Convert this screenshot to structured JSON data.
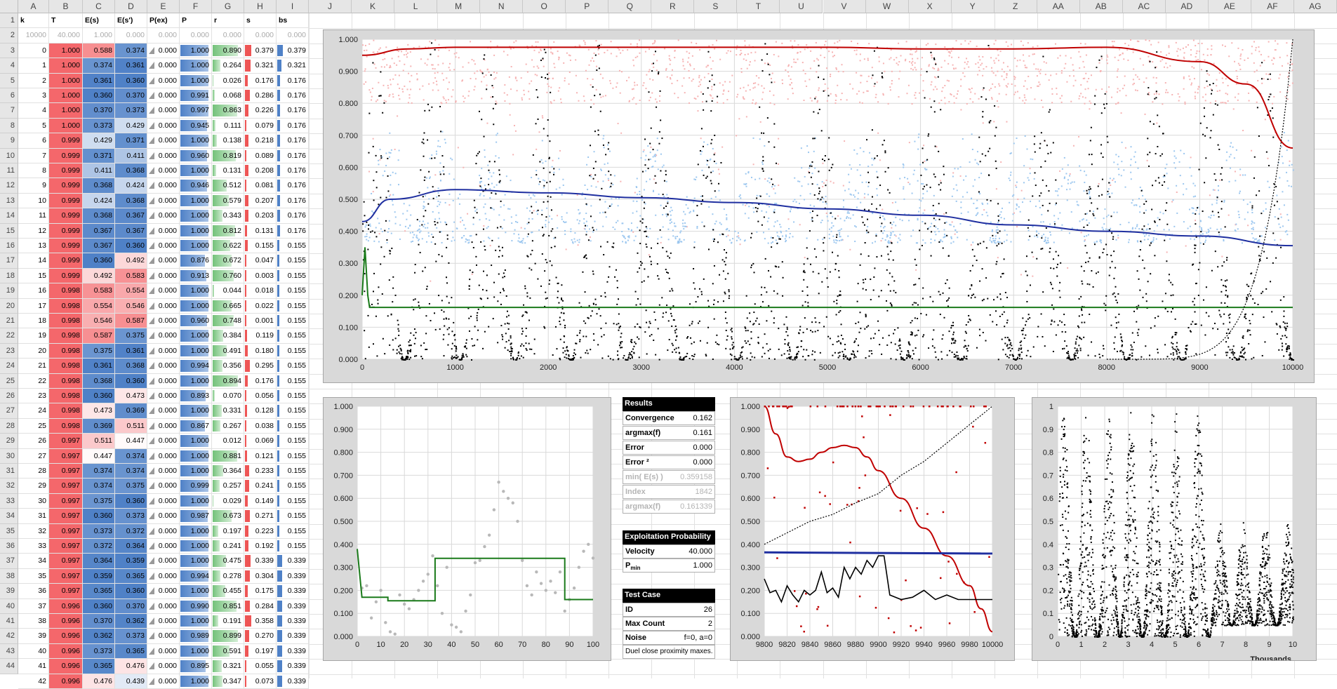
{
  "columns": [
    "A",
    "B",
    "C",
    "D",
    "E",
    "F",
    "G",
    "H",
    "I",
    "J",
    "K",
    "L",
    "M",
    "N",
    "O",
    "P",
    "Q",
    "R",
    "S",
    "T",
    "U",
    "V",
    "W",
    "X",
    "Y",
    "Z",
    "AA",
    "AB",
    "AC",
    "AD",
    "AE",
    "AF",
    "AG"
  ],
  "header_row": {
    "k": "k",
    "T": "T",
    "Es": "E(s)",
    "Esp": "E(s')",
    "Pex": "P(ex)",
    "P": "P",
    "r": "r",
    "s": "s",
    "bs": "bs"
  },
  "row2": [
    "10000",
    "40.000",
    "1.000",
    "0.000",
    "0.000",
    "0.000",
    "0.000",
    "0.000",
    "0.000"
  ],
  "rows": [
    [
      0,
      "1.000",
      "0.588",
      "0.374",
      "0.000",
      "1.000",
      "0.890",
      "0.379",
      "0.379"
    ],
    [
      1,
      "1.000",
      "0.374",
      "0.361",
      "0.000",
      "1.000",
      "0.264",
      "0.321",
      "0.321"
    ],
    [
      2,
      "1.000",
      "0.361",
      "0.360",
      "0.000",
      "1.000",
      "0.026",
      "0.176",
      "0.176"
    ],
    [
      3,
      "1.000",
      "0.360",
      "0.370",
      "0.000",
      "0.991",
      "0.068",
      "0.286",
      "0.176"
    ],
    [
      4,
      "1.000",
      "0.370",
      "0.373",
      "0.000",
      "0.997",
      "0.863",
      "0.226",
      "0.176"
    ],
    [
      5,
      "1.000",
      "0.373",
      "0.429",
      "0.000",
      "0.945",
      "0.111",
      "0.079",
      "0.176"
    ],
    [
      6,
      "0.999",
      "0.429",
      "0.371",
      "0.000",
      "1.000",
      "0.138",
      "0.218",
      "0.176"
    ],
    [
      7,
      "0.999",
      "0.371",
      "0.411",
      "0.000",
      "0.960",
      "0.819",
      "0.089",
      "0.176"
    ],
    [
      8,
      "0.999",
      "0.411",
      "0.368",
      "0.000",
      "1.000",
      "0.131",
      "0.208",
      "0.176"
    ],
    [
      9,
      "0.999",
      "0.368",
      "0.424",
      "0.000",
      "0.946",
      "0.512",
      "0.081",
      "0.176"
    ],
    [
      10,
      "0.999",
      "0.424",
      "0.368",
      "0.000",
      "1.000",
      "0.579",
      "0.207",
      "0.176"
    ],
    [
      11,
      "0.999",
      "0.368",
      "0.367",
      "0.000",
      "1.000",
      "0.343",
      "0.203",
      "0.176"
    ],
    [
      12,
      "0.999",
      "0.367",
      "0.367",
      "0.000",
      "1.000",
      "0.812",
      "0.131",
      "0.176"
    ],
    [
      13,
      "0.999",
      "0.367",
      "0.360",
      "0.000",
      "1.000",
      "0.622",
      "0.155",
      "0.155"
    ],
    [
      14,
      "0.999",
      "0.360",
      "0.492",
      "0.000",
      "0.876",
      "0.672",
      "0.047",
      "0.155"
    ],
    [
      15,
      "0.999",
      "0.492",
      "0.583",
      "0.000",
      "0.913",
      "0.760",
      "0.003",
      "0.155"
    ],
    [
      16,
      "0.998",
      "0.583",
      "0.554",
      "0.000",
      "1.000",
      "0.044",
      "0.018",
      "0.155"
    ],
    [
      17,
      "0.998",
      "0.554",
      "0.546",
      "0.000",
      "1.000",
      "0.665",
      "0.022",
      "0.155"
    ],
    [
      18,
      "0.998",
      "0.546",
      "0.587",
      "0.000",
      "0.960",
      "0.748",
      "0.001",
      "0.155"
    ],
    [
      19,
      "0.998",
      "0.587",
      "0.375",
      "0.000",
      "1.000",
      "0.384",
      "0.119",
      "0.155"
    ],
    [
      20,
      "0.998",
      "0.375",
      "0.361",
      "0.000",
      "1.000",
      "0.491",
      "0.180",
      "0.155"
    ],
    [
      21,
      "0.998",
      "0.361",
      "0.368",
      "0.000",
      "0.994",
      "0.356",
      "0.295",
      "0.155"
    ],
    [
      22,
      "0.998",
      "0.368",
      "0.360",
      "0.000",
      "1.000",
      "0.894",
      "0.176",
      "0.155"
    ],
    [
      23,
      "0.998",
      "0.360",
      "0.473",
      "0.000",
      "0.893",
      "0.070",
      "0.056",
      "0.155"
    ],
    [
      24,
      "0.998",
      "0.473",
      "0.369",
      "0.000",
      "1.000",
      "0.331",
      "0.128",
      "0.155"
    ],
    [
      25,
      "0.998",
      "0.369",
      "0.511",
      "0.000",
      "0.867",
      "0.267",
      "0.038",
      "0.155"
    ],
    [
      26,
      "0.997",
      "0.511",
      "0.447",
      "0.000",
      "1.000",
      "0.012",
      "0.069",
      "0.155"
    ],
    [
      27,
      "0.997",
      "0.447",
      "0.374",
      "0.000",
      "1.000",
      "0.881",
      "0.121",
      "0.155"
    ],
    [
      28,
      "0.997",
      "0.374",
      "0.374",
      "0.000",
      "1.000",
      "0.364",
      "0.233",
      "0.155"
    ],
    [
      29,
      "0.997",
      "0.374",
      "0.375",
      "0.000",
      "0.999",
      "0.257",
      "0.241",
      "0.155"
    ],
    [
      30,
      "0.997",
      "0.375",
      "0.360",
      "0.000",
      "1.000",
      "0.029",
      "0.149",
      "0.155"
    ],
    [
      31,
      "0.997",
      "0.360",
      "0.373",
      "0.000",
      "0.987",
      "0.673",
      "0.271",
      "0.155"
    ],
    [
      32,
      "0.997",
      "0.373",
      "0.372",
      "0.000",
      "1.000",
      "0.197",
      "0.223",
      "0.155"
    ],
    [
      33,
      "0.997",
      "0.372",
      "0.364",
      "0.000",
      "1.000",
      "0.241",
      "0.192",
      "0.155"
    ],
    [
      34,
      "0.997",
      "0.364",
      "0.359",
      "0.000",
      "1.000",
      "0.475",
      "0.339",
      "0.339"
    ],
    [
      35,
      "0.997",
      "0.359",
      "0.365",
      "0.000",
      "0.994",
      "0.278",
      "0.304",
      "0.339"
    ],
    [
      36,
      "0.997",
      "0.365",
      "0.360",
      "0.000",
      "1.000",
      "0.455",
      "0.175",
      "0.339"
    ],
    [
      37,
      "0.996",
      "0.360",
      "0.370",
      "0.000",
      "0.990",
      "0.851",
      "0.284",
      "0.339"
    ],
    [
      38,
      "0.996",
      "0.370",
      "0.362",
      "0.000",
      "1.000",
      "0.191",
      "0.358",
      "0.339"
    ],
    [
      39,
      "0.996",
      "0.362",
      "0.373",
      "0.000",
      "0.989",
      "0.899",
      "0.270",
      "0.339"
    ],
    [
      40,
      "0.996",
      "0.373",
      "0.365",
      "0.000",
      "1.000",
      "0.591",
      "0.197",
      "0.339"
    ],
    [
      41,
      "0.996",
      "0.365",
      "0.476",
      "0.000",
      "0.895",
      "0.321",
      "0.055",
      "0.339"
    ],
    [
      42,
      "0.996",
      "0.476",
      "0.439",
      "0.000",
      "1.000",
      "0.347",
      "0.073",
      "0.339"
    ]
  ],
  "results": {
    "title": "Results",
    "items": [
      {
        "label": "Convergence",
        "value": "0.162"
      },
      {
        "label": "argmax(f)",
        "value": "0.161"
      },
      {
        "label": "Error",
        "value": "0.000"
      },
      {
        "label": "Error ²",
        "value": "0.000"
      },
      {
        "label": "min( E(s) )",
        "value": "0.359158"
      },
      {
        "label": "Index",
        "value": "1842"
      },
      {
        "label": "argmax(f)",
        "value": "0.161339"
      }
    ]
  },
  "exploitation": {
    "title": "Exploitation Probability",
    "items": [
      {
        "label": "Velocity",
        "value": "40.000"
      },
      {
        "label": "Pmin",
        "value": "1.000"
      }
    ]
  },
  "test_case": {
    "title": "Test Case",
    "items": [
      {
        "label": "ID",
        "value": "26"
      },
      {
        "label": "Max Count",
        "value": "2"
      },
      {
        "label": "Noise",
        "value": "f=0, a=0"
      }
    ],
    "note": "Duel close proximity maxes."
  },
  "colors": {
    "red": "#f4676b",
    "pink": "#f7c4c4",
    "blue": "#4f81c7",
    "lightblue": "#bcd3ee",
    "green": "#74c27a",
    "darkred": "#c00000",
    "navy": "#1f2fa0",
    "darkgreen": "#1a7a1a"
  },
  "chart_data": [
    {
      "type": "scatter",
      "title": "",
      "x_ticks": [
        "0",
        "1000",
        "2000",
        "3000",
        "4000",
        "5000",
        "6000",
        "7000",
        "8000",
        "9000",
        "10000"
      ],
      "y_ticks": [
        "0.000",
        "0.100",
        "0.200",
        "0.300",
        "0.400",
        "0.500",
        "0.600",
        "0.700",
        "0.800",
        "0.900",
        "1.000"
      ],
      "xlim": [
        0,
        10000
      ],
      "ylim": [
        0,
        1
      ],
      "series": [
        {
          "kind": "trend",
          "color": "#c00000",
          "x": [
            0,
            500,
            1000,
            2000,
            3000,
            4000,
            5000,
            6000,
            7000,
            8000,
            9000,
            9500,
            10000
          ],
          "y": [
            0.95,
            0.97,
            0.975,
            0.975,
            0.975,
            0.975,
            0.975,
            0.97,
            0.97,
            0.975,
            0.93,
            0.86,
            0.66
          ]
        },
        {
          "kind": "trend",
          "color": "#1f2fa0",
          "x": [
            0,
            300,
            1000,
            2000,
            3000,
            4000,
            5000,
            6000,
            7000,
            8000,
            9000,
            10000
          ],
          "y": [
            0.43,
            0.5,
            0.53,
            0.52,
            0.505,
            0.49,
            0.47,
            0.45,
            0.42,
            0.4,
            0.385,
            0.355
          ]
        },
        {
          "kind": "step",
          "color": "#1a7a1a",
          "x": [
            0,
            30,
            60,
            80,
            10000
          ],
          "y": [
            0.2,
            0.35,
            0.2,
            0.162,
            0.162
          ]
        }
      ]
    },
    {
      "type": "line",
      "x_ticks": [
        "0",
        "10",
        "20",
        "30",
        "40",
        "50",
        "60",
        "70",
        "80",
        "90",
        "100"
      ],
      "y_ticks": [
        "0.000",
        "0.100",
        "0.200",
        "0.300",
        "0.400",
        "0.500",
        "0.600",
        "0.700",
        "0.800",
        "0.900",
        "1.000"
      ],
      "xlim": [
        0,
        100
      ],
      "ylim": [
        0,
        1
      ],
      "step": {
        "x": [
          0,
          2,
          13,
          13,
          33,
          33,
          88,
          88,
          100
        ],
        "y": [
          0.38,
          0.17,
          0.17,
          0.155,
          0.155,
          0.339,
          0.339,
          0.16,
          0.16
        ]
      },
      "points": {
        "x": [
          2,
          4,
          6,
          8,
          10,
          12,
          14,
          16,
          18,
          20,
          22,
          24,
          26,
          28,
          30,
          32,
          34,
          36,
          38,
          40,
          42,
          44,
          46,
          48,
          50,
          52,
          54,
          56,
          58,
          60,
          62,
          64,
          66,
          68,
          70,
          72,
          74,
          76,
          78,
          80,
          82,
          84,
          86,
          88,
          90,
          92,
          94,
          96,
          98,
          100
        ],
        "y": [
          0.21,
          0.22,
          0.08,
          0.15,
          0.2,
          0.06,
          0.02,
          0.01,
          0.18,
          0.14,
          0.12,
          0.16,
          0.2,
          0.24,
          0.27,
          0.35,
          0.22,
          0.1,
          0.3,
          0.05,
          0.04,
          0.02,
          0.11,
          0.18,
          0.32,
          0.33,
          0.39,
          0.44,
          0.55,
          0.67,
          0.63,
          0.6,
          0.58,
          0.5,
          0.33,
          0.22,
          0.18,
          0.28,
          0.23,
          0.2,
          0.24,
          0.19,
          0.28,
          0.11,
          0.16,
          0.21,
          0.3,
          0.37,
          0.4,
          0.34
        ]
      }
    },
    {
      "type": "scatter",
      "x_ticks": [
        "9800",
        "9820",
        "9840",
        "9860",
        "9880",
        "9900",
        "9920",
        "9940",
        "9960",
        "9980",
        "10000"
      ],
      "y_ticks": [
        "0.000",
        "0.100",
        "0.200",
        "0.300",
        "0.400",
        "0.500",
        "0.600",
        "0.700",
        "0.800",
        "0.900",
        "1.000"
      ],
      "xlim": [
        9800,
        10000
      ],
      "ylim": [
        0,
        1
      ],
      "red_curve": {
        "x": [
          9800,
          9810,
          9820,
          9830,
          9840,
          9850,
          9860,
          9870,
          9880,
          9890,
          9900,
          9920,
          9940,
          9960,
          9980,
          9990,
          10000
        ],
        "y": [
          1.0,
          0.88,
          0.78,
          0.76,
          0.77,
          0.8,
          0.82,
          0.83,
          0.82,
          0.78,
          0.72,
          0.6,
          0.47,
          0.35,
          0.22,
          0.12,
          0.02
        ]
      },
      "blue_line": {
        "x": [
          9800,
          10000
        ],
        "y": [
          0.365,
          0.36
        ]
      },
      "black_line": {
        "x": [
          9800,
          9805,
          9810,
          9815,
          9820,
          9825,
          9830,
          9835,
          9840,
          9845,
          9850,
          9855,
          9860,
          9865,
          9870,
          9875,
          9880,
          9885,
          9890,
          9895,
          9900,
          9905,
          9910,
          9920,
          9930,
          9940,
          9950,
          9960,
          9970,
          9980,
          9990,
          10000
        ],
        "y": [
          0.25,
          0.19,
          0.2,
          0.15,
          0.22,
          0.18,
          0.15,
          0.2,
          0.18,
          0.2,
          0.28,
          0.19,
          0.21,
          0.17,
          0.3,
          0.25,
          0.3,
          0.27,
          0.33,
          0.3,
          0.35,
          0.35,
          0.18,
          0.16,
          0.17,
          0.2,
          0.16,
          0.18,
          0.16,
          0.16,
          0.16,
          0.16
        ]
      },
      "dotted_line": {
        "x": [
          9800,
          9820,
          9840,
          9860,
          9880,
          9900,
          9920,
          9940,
          9960,
          9980,
          10000
        ],
        "y": [
          0.4,
          0.45,
          0.5,
          0.53,
          0.58,
          0.62,
          0.7,
          0.76,
          0.84,
          0.92,
          1.0
        ]
      }
    },
    {
      "type": "scatter",
      "x_ticks": [
        "0",
        "1",
        "2",
        "3",
        "4",
        "5",
        "6",
        "7",
        "8",
        "9",
        "10"
      ],
      "x_label": "Thousands",
      "y_ticks": [
        "0",
        "0.1",
        "0.2",
        "0.3",
        "0.4",
        "0.5",
        "0.6",
        "0.7",
        "0.8",
        "0.9",
        "1"
      ],
      "xlim": [
        0,
        10
      ],
      "ylim": [
        0,
        1
      ]
    }
  ]
}
